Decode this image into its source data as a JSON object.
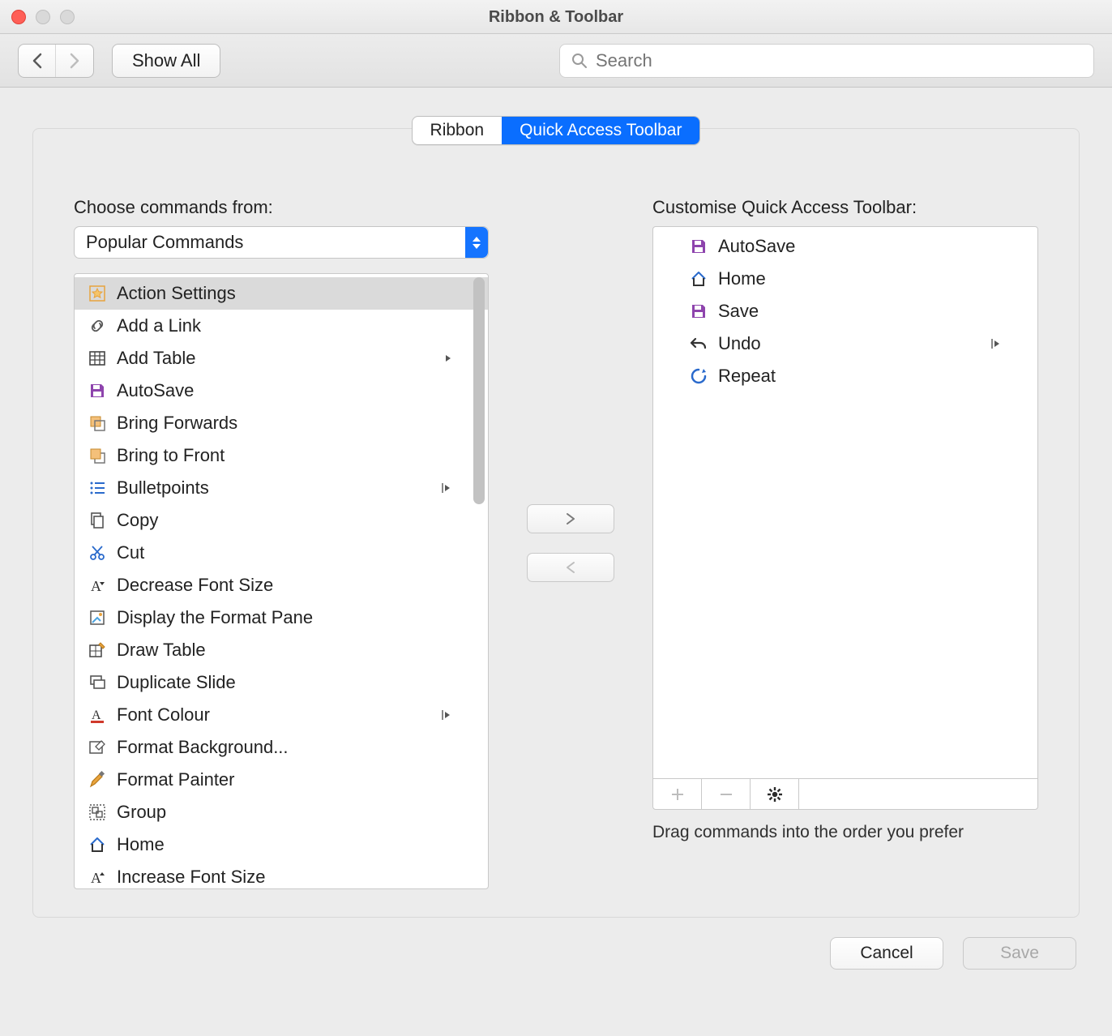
{
  "window": {
    "title": "Ribbon & Toolbar"
  },
  "toolbar": {
    "show_all": "Show All",
    "search_placeholder": "Search"
  },
  "tabs": {
    "ribbon": "Ribbon",
    "qat": "Quick Access Toolbar"
  },
  "left": {
    "heading": "Choose commands from:",
    "select_value": "Popular Commands",
    "items": [
      {
        "label": "Action Settings",
        "icon": "star",
        "selected": true
      },
      {
        "label": "Add a Link",
        "icon": "link"
      },
      {
        "label": "Add Table",
        "icon": "table",
        "submenu": true
      },
      {
        "label": "AutoSave",
        "icon": "save-purple"
      },
      {
        "label": "Bring Forwards",
        "icon": "bring-fwd"
      },
      {
        "label": "Bring to Front",
        "icon": "bring-front"
      },
      {
        "label": "Bulletpoints",
        "icon": "bullets",
        "submenu_split": true
      },
      {
        "label": "Copy",
        "icon": "copy"
      },
      {
        "label": "Cut",
        "icon": "scissors"
      },
      {
        "label": "Decrease Font Size",
        "icon": "font-dec"
      },
      {
        "label": "Display the Format Pane",
        "icon": "format-pane"
      },
      {
        "label": "Draw Table",
        "icon": "draw-table"
      },
      {
        "label": "Duplicate Slide",
        "icon": "dup-slide"
      },
      {
        "label": "Font Colour",
        "icon": "font-colour",
        "submenu_split": true
      },
      {
        "label": "Format Background...",
        "icon": "format-bg"
      },
      {
        "label": "Format Painter",
        "icon": "paintbrush"
      },
      {
        "label": "Group",
        "icon": "group"
      },
      {
        "label": "Home",
        "icon": "home"
      },
      {
        "label": "Increase Font Size",
        "icon": "font-inc"
      }
    ]
  },
  "right": {
    "heading": "Customise Quick Access Toolbar:",
    "items": [
      {
        "label": "AutoSave",
        "icon": "save-purple"
      },
      {
        "label": "Home",
        "icon": "home"
      },
      {
        "label": "Save",
        "icon": "save-purple"
      },
      {
        "label": "Undo",
        "icon": "undo",
        "submenu_split": true
      },
      {
        "label": "Repeat",
        "icon": "repeat"
      }
    ],
    "hint": "Drag commands into the order you prefer"
  },
  "footer": {
    "cancel": "Cancel",
    "save": "Save"
  },
  "colors": {
    "accent": "#0a6eff",
    "purple": "#8e44ad",
    "orange": "#e67e22"
  }
}
